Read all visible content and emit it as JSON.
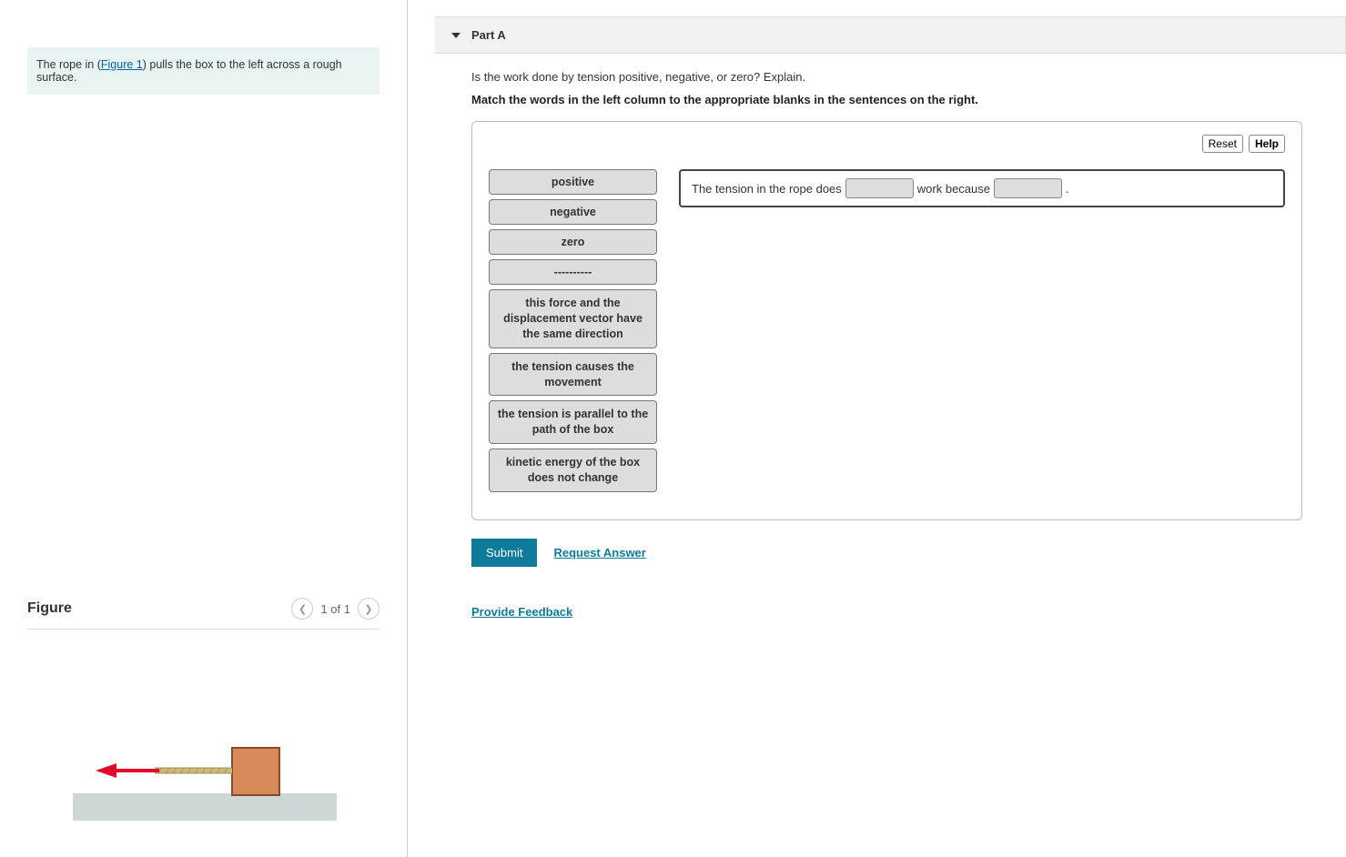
{
  "problem": {
    "prefix": "The rope in (",
    "figure_link": "Figure 1",
    "suffix": ") pulls the box to the left across a rough surface."
  },
  "figure": {
    "title": "Figure",
    "pager": "1 of 1"
  },
  "part": {
    "label": "Part A",
    "question": "Is the work done by tension positive, negative, or zero? Explain.",
    "instruction": "Match the words in the left column to the appropriate blanks in the sentences on the right."
  },
  "toolbar": {
    "reset": "Reset",
    "help": "Help"
  },
  "drag_items": [
    "positive",
    "negative",
    "zero",
    "----------",
    "this force and the displacement vector have the same direction",
    "the tension causes the movement",
    "the tension is parallel to the path of the box",
    "kinetic energy of the box does not change"
  ],
  "sentence": {
    "seg1": "The tension in the rope does",
    "seg2": "work because",
    "seg3": "."
  },
  "actions": {
    "submit": "Submit",
    "request_answer": "Request Answer"
  },
  "feedback": "Provide Feedback"
}
